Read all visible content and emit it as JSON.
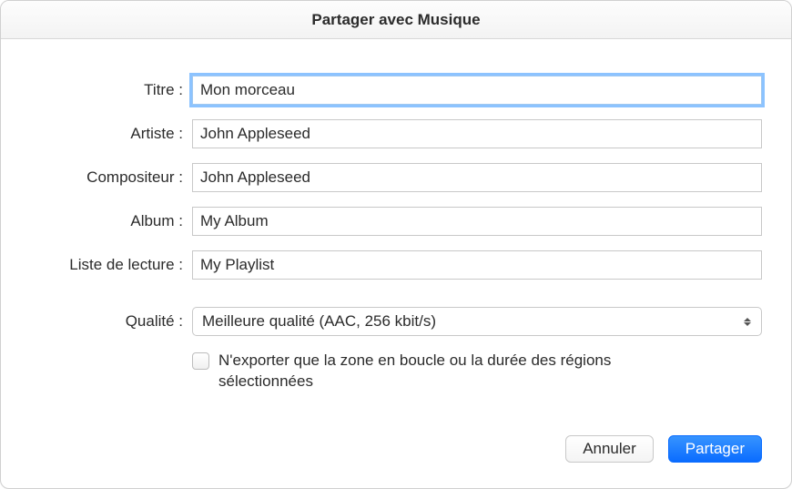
{
  "window": {
    "title": "Partager avec Musique"
  },
  "form": {
    "title_label": "Titre :",
    "title_value": "Mon morceau",
    "artist_label": "Artiste :",
    "artist_value": "John Appleseed",
    "composer_label": "Compositeur :",
    "composer_value": "John Appleseed",
    "album_label": "Album :",
    "album_value": "My Album",
    "playlist_label": "Liste de lecture :",
    "playlist_value": "My Playlist",
    "quality_label": "Qualité :",
    "quality_value": "Meilleure qualité (AAC, 256 kbit/s)",
    "export_checkbox_label": "N'exporter que la zone en boucle ou la durée des régions sélectionnées",
    "export_checkbox_checked": false
  },
  "footer": {
    "cancel_label": "Annuler",
    "share_label": "Partager"
  }
}
